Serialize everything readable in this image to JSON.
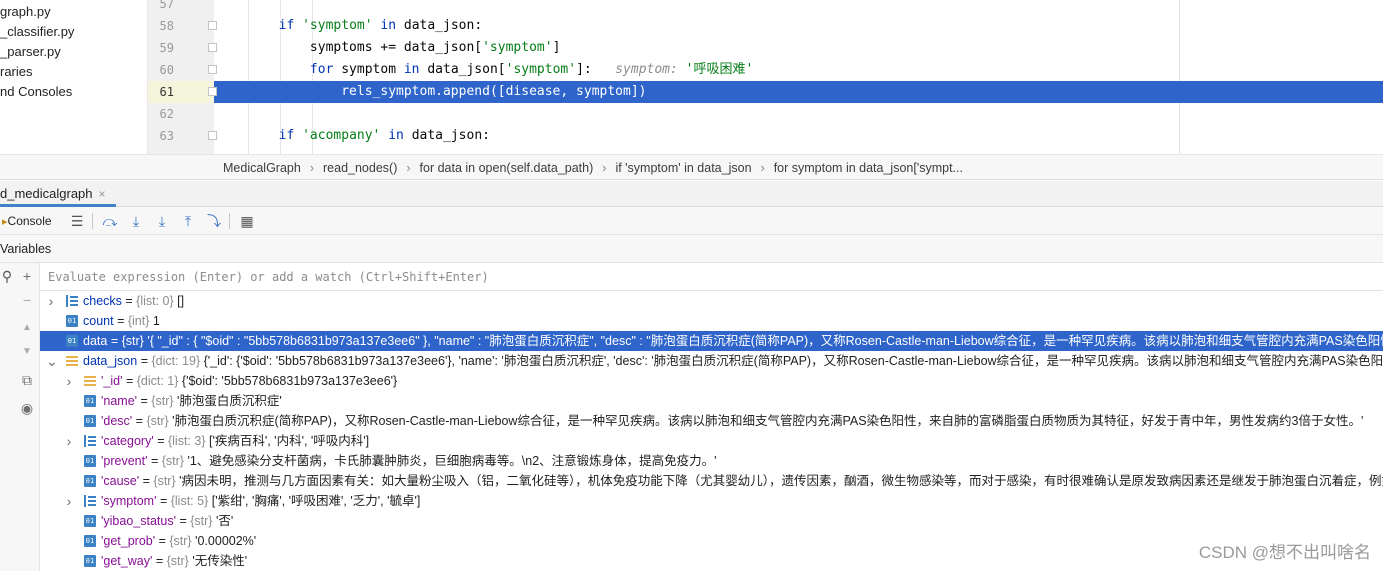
{
  "project_tree": [
    "graph.py",
    "_classifier.py",
    "_parser.py",
    "raries",
    "nd Consoles"
  ],
  "editor": {
    "lines": [
      {
        "num": "57",
        "indent": "",
        "tokens": []
      },
      {
        "num": "58",
        "indent": "        ",
        "tokens": [
          [
            "kw",
            "if "
          ],
          [
            "str",
            "'symptom'"
          ],
          [
            "kw",
            " in "
          ],
          [
            "plain",
            "data_json:"
          ]
        ]
      },
      {
        "num": "59",
        "indent": "            ",
        "tokens": [
          [
            "plain",
            "symptoms += data_json["
          ],
          [
            "str",
            "'symptom'"
          ],
          [
            "plain",
            "]"
          ]
        ]
      },
      {
        "num": "60",
        "indent": "            ",
        "tokens": [
          [
            "kw",
            "for "
          ],
          [
            "plain",
            "symptom "
          ],
          [
            "kw",
            "in "
          ],
          [
            "plain",
            "data_json["
          ],
          [
            "str",
            "'symptom'"
          ],
          [
            "plain",
            "]:"
          ]
        ],
        "hint_var": "symptom:",
        "hint_val": "'呼吸困难'"
      },
      {
        "num": "61",
        "indent": "                ",
        "tokens": [
          [
            "plain",
            "rels_symptom.append([disease, symptom])"
          ]
        ],
        "current": true
      },
      {
        "num": "62",
        "indent": "",
        "tokens": []
      },
      {
        "num": "63",
        "indent": "        ",
        "tokens": [
          [
            "kw",
            "if "
          ],
          [
            "str",
            "'acompany'"
          ],
          [
            "kw",
            " in "
          ],
          [
            "plain",
            "data_json:"
          ]
        ]
      }
    ]
  },
  "breadcrumbs": [
    "MedicalGraph",
    "read_nodes()",
    "for data in open(self.data_path)",
    "if 'symptom' in data_json",
    "for symptom in data_json['sympt..."
  ],
  "debug": {
    "tab_label": "d_medicalgraph",
    "tab_close": "×",
    "console_label": "Console",
    "variables_label": "Variables",
    "eval_placeholder": "Evaluate expression (Enter) or add a watch (Ctrl+Shift+Enter)"
  },
  "variables": [
    {
      "level": 0,
      "expand": true,
      "icon": "list",
      "name": "checks",
      "type": "{list: 0}",
      "value": "[]"
    },
    {
      "level": 0,
      "expand": false,
      "icon": "int",
      "name": "count",
      "type": "{int}",
      "value": "1"
    },
    {
      "level": 0,
      "expand": false,
      "icon": "int",
      "name": "data",
      "type": "{str}",
      "value": "'{ \"_id\" : { \"$oid\" : \"5bb578b6831b973a137e3ee6\" }, \"name\" : \"肺泡蛋白质沉积症\", \"desc\" : \"肺泡蛋白质沉积症(简称PAP)，又称Rosen-Castle-man-Liebow综合征，是一种罕见疾病。该病以肺泡和细支气管腔内充满PAS染色阳性",
      "selected": true
    },
    {
      "level": 0,
      "expand": true,
      "open": true,
      "icon": "dict",
      "name": "data_json",
      "type": "{dict: 19}",
      "value": "{'_id': {'$oid': '5bb578b6831b973a137e3ee6'}, 'name': '肺泡蛋白质沉积症', 'desc': '肺泡蛋白质沉积症(简称PAP)，又称Rosen-Castle-man-Liebow综合征，是一种罕见疾病。该病以肺泡和细支气管腔内充满PAS染色阳性"
    },
    {
      "level": 1,
      "expand": true,
      "icon": "dict",
      "name": "'_id'",
      "type": "{dict: 1}",
      "value": "{'$oid': '5bb578b6831b973a137e3ee6'}"
    },
    {
      "level": 1,
      "expand": false,
      "icon": "int",
      "name": "'name'",
      "type": "{str}",
      "value": "'肺泡蛋白质沉积症'"
    },
    {
      "level": 1,
      "expand": false,
      "icon": "int",
      "name": "'desc'",
      "type": "{str}",
      "value": "'肺泡蛋白质沉积症(简称PAP)，又称Rosen-Castle-man-Liebow综合征，是一种罕见疾病。该病以肺泡和细支气管腔内充满PAS染色阳性，来自肺的富磷脂蛋白质物质为其特征，好发于青中年，男性发病约3倍于女性。'"
    },
    {
      "level": 1,
      "expand": true,
      "icon": "list",
      "name": "'category'",
      "type": "{list: 3}",
      "value": "['疾病百科', '内科', '呼吸内科']"
    },
    {
      "level": 1,
      "expand": false,
      "icon": "int",
      "name": "'prevent'",
      "type": "{str}",
      "value": "'1、避免感染分支杆菌病，卡氏肺囊肿肺炎，巨细胞病毒等。\\n2、注意锻炼身体，提高免疫力。'"
    },
    {
      "level": 1,
      "expand": false,
      "icon": "int",
      "name": "'cause'",
      "type": "{str}",
      "value": "'病因未明，推测与几方面因素有关：如大量粉尘吸入（铝，二氧化硅等），机体免疫功能下降（尤其婴幼儿），遗传因素，酗酒，微生物感染等，而对于感染，有时很难确认是原发致病因素还是继发于肺泡蛋白沉着症，例如巨细"
    },
    {
      "level": 1,
      "expand": true,
      "icon": "list",
      "name": "'symptom'",
      "type": "{list: 5}",
      "value": "['紫绀', '胸痛', '呼吸困难', '乏力', '毓卓']"
    },
    {
      "level": 1,
      "expand": false,
      "icon": "int",
      "name": "'yibao_status'",
      "type": "{str}",
      "value": "'否'"
    },
    {
      "level": 1,
      "expand": false,
      "icon": "int",
      "name": "'get_prob'",
      "type": "{str}",
      "value": "'0.00002%'"
    },
    {
      "level": 1,
      "expand": false,
      "icon": "int",
      "name": "'get_way'",
      "type": "{str}",
      "value": "'无传染性'"
    }
  ],
  "watermark": "CSDN @想不出叫啥名"
}
